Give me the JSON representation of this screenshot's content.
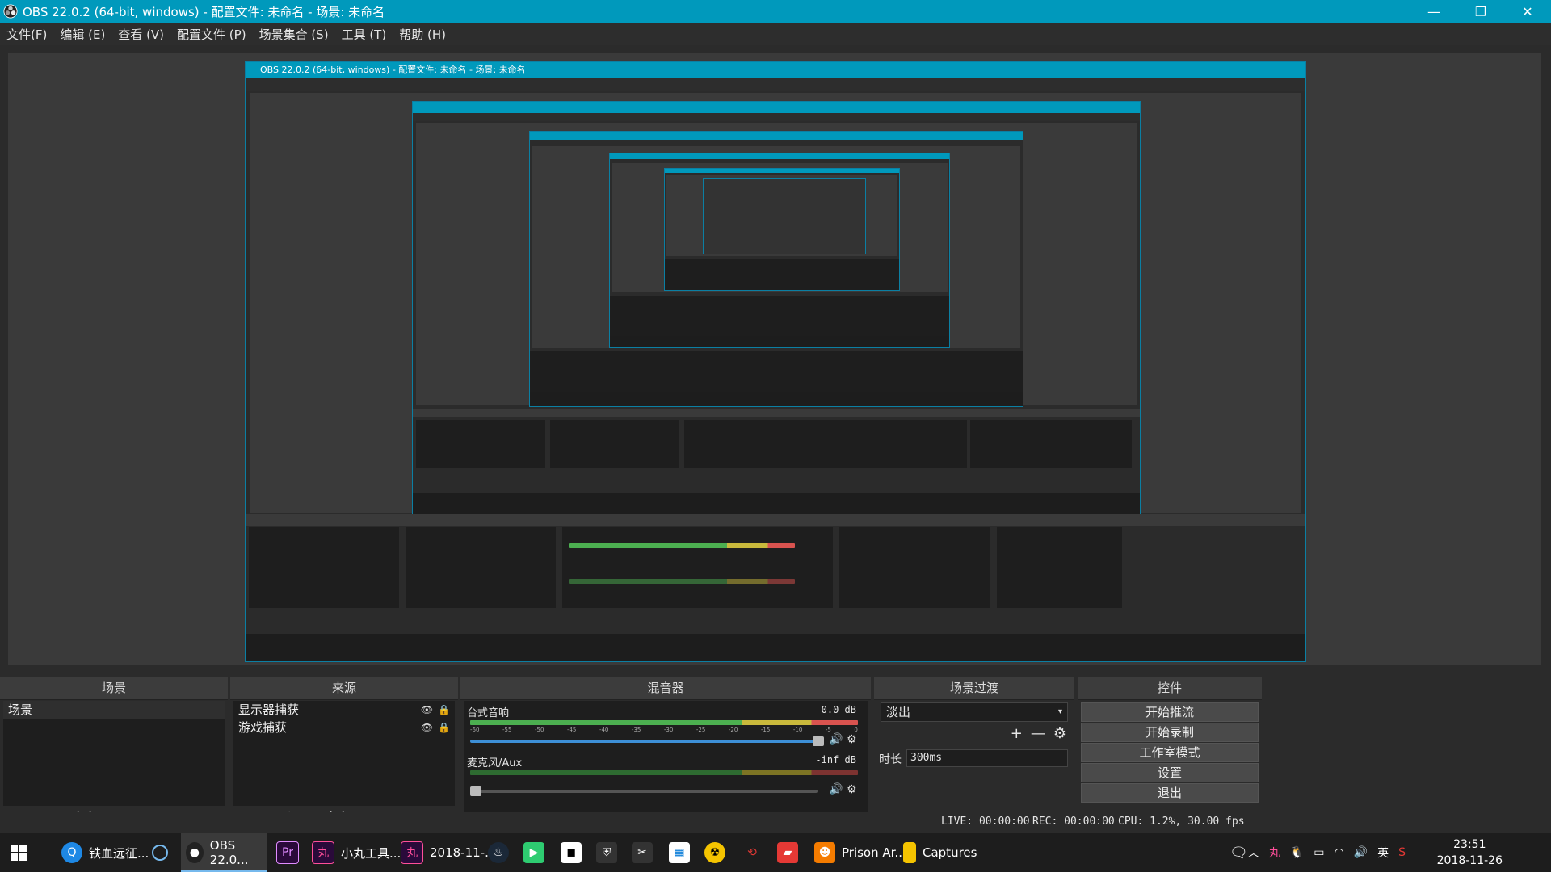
{
  "window": {
    "title": "OBS 22.0.2 (64-bit, windows) - 配置文件: 未命名 - 场景: 未命名",
    "controls": {
      "minimize": "—",
      "restore": "❐",
      "close": "✕"
    }
  },
  "menu": {
    "items": [
      "文件(F)",
      "编辑 (E)",
      "查看 (V)",
      "配置文件 (P)",
      "场景集合 (S)",
      "工具 (T)",
      "帮助 (H)"
    ]
  },
  "docks": {
    "scenes": {
      "title": "场景",
      "items": [
        "场景"
      ]
    },
    "sources": {
      "title": "来源",
      "items": [
        "显示器捕获",
        "游戏捕获"
      ]
    },
    "mixer": {
      "title": "混音器",
      "tracks": [
        {
          "name": "台式音响",
          "db": "0.0 dB"
        },
        {
          "name": "麦克风/Aux",
          "db": "-inf dB"
        }
      ],
      "scale": [
        "-60",
        "-55",
        "-50",
        "-45",
        "-40",
        "-35",
        "-30",
        "-25",
        "-20",
        "-15",
        "-10",
        "-5",
        "0"
      ]
    },
    "transitions": {
      "title": "场景过渡",
      "selected": "淡出",
      "duration_label": "时长",
      "duration_value": "300ms"
    },
    "controls": {
      "title": "控件",
      "buttons": [
        "开始推流",
        "开始录制",
        "工作室模式",
        "设置",
        "退出"
      ]
    }
  },
  "status": {
    "live": "LIVE: 00:00:00",
    "rec": "REC: 00:00:00",
    "cpu": "CPU: 1.2%, 30.00 fps"
  },
  "taskbar": {
    "apps": [
      "铁血远征...",
      "OBS 22.0...",
      "小丸工具...",
      "2018-11-...",
      "Prison Ar...",
      "Captures"
    ],
    "ime": "英",
    "time": "23:51",
    "date": "2018-11-26"
  },
  "colors": {
    "accent": "#0099bc",
    "meter_green": "#4caf50",
    "meter_yellow": "#c9b93c",
    "meter_red": "#d9534f",
    "slider_blue": "#3d8fd6"
  }
}
